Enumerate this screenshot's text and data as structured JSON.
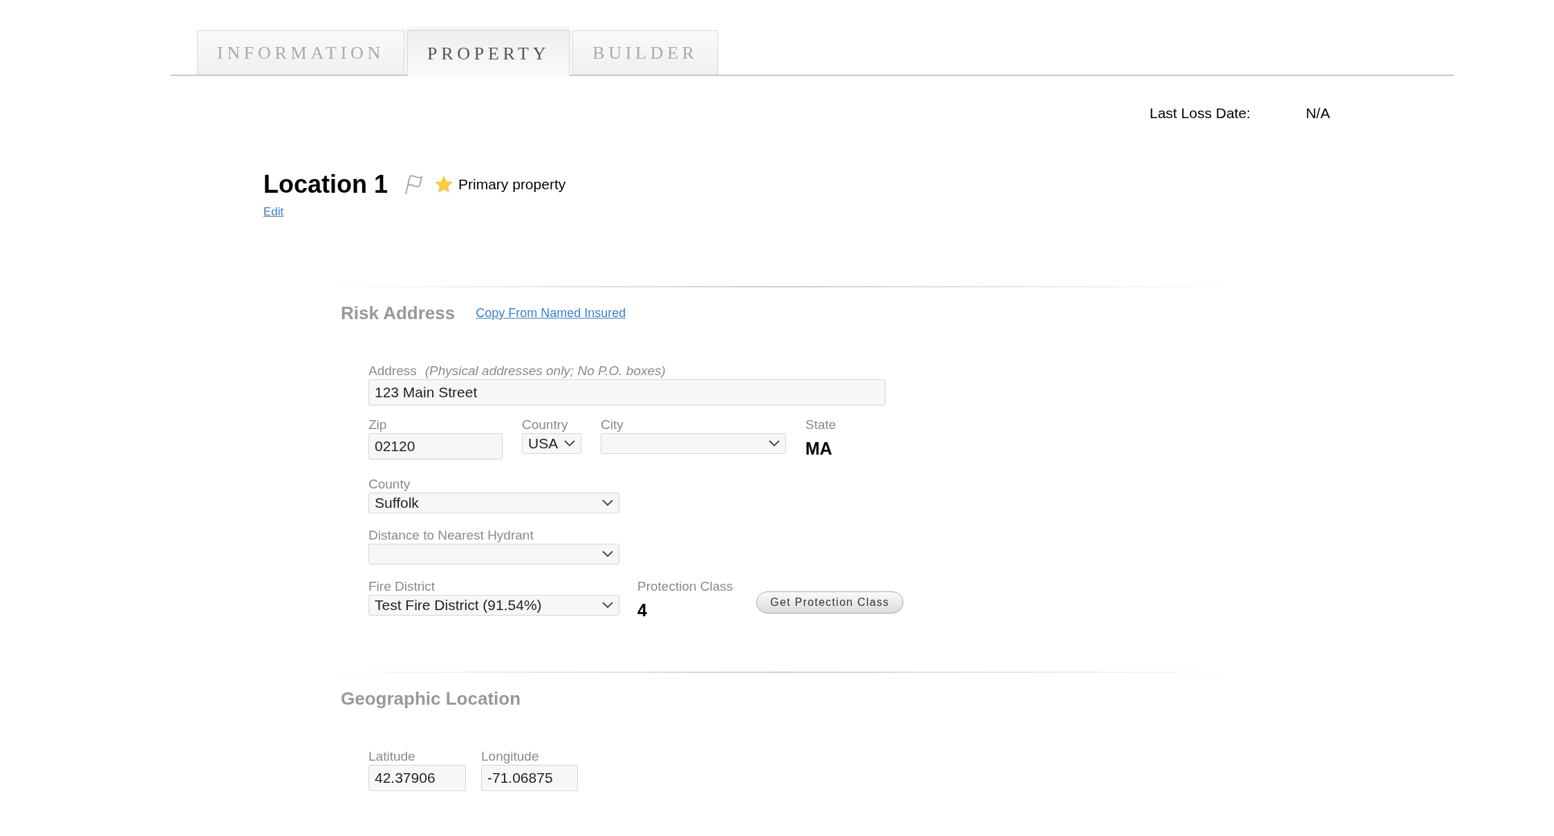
{
  "tabs": [
    {
      "label": "INFORMATION",
      "selected": false
    },
    {
      "label": "PROPERTY",
      "selected": true
    },
    {
      "label": "BUILDER",
      "selected": false
    }
  ],
  "last_loss": {
    "label": "Last Loss Date:",
    "value": "N/A"
  },
  "location": {
    "title": "Location 1",
    "primary": true,
    "primary_label": "Primary property",
    "edit_link": "Edit"
  },
  "risk_address": {
    "heading": "Risk Address",
    "link": "Copy From Named Insured",
    "address": {
      "label": "Address",
      "hint": "(Physical addresses only; No P.O. boxes)",
      "value": "123 Main Street"
    },
    "zip": {
      "label": "Zip",
      "value": "02120"
    },
    "country": {
      "label": "Country",
      "value": "USA"
    },
    "city": {
      "label": "City"
    },
    "state": {
      "label": "State",
      "value": "MA"
    },
    "county": {
      "label": "County",
      "value": "Suffolk"
    },
    "hydrant": {
      "label": "Distance to Nearest Hydrant"
    },
    "fire_district": {
      "label": "Fire District",
      "value": "Test Fire District (91.54%)"
    },
    "protection_class": {
      "label": "Protection Class",
      "value": "4"
    },
    "button": "Get Protection Class"
  },
  "geographic_location": {
    "heading": "Geographic Location",
    "latitude": {
      "label": "Latitude",
      "value": "42.37906"
    },
    "longitude": {
      "label": "Longitude",
      "value": "-71.06875"
    }
  }
}
